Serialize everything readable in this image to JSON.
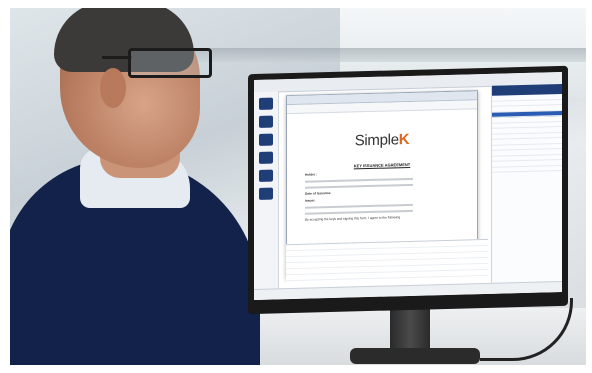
{
  "brand": {
    "logo_main": "Simple",
    "logo_accent": "K",
    "accent_color": "#e0651e",
    "nav_color": "#1f3e78"
  },
  "document": {
    "title": "KEY ISSUANCE AGREEMENT",
    "holder_label": "Holder :",
    "issuer_label": "Issuer:",
    "date_of_issuance_label": "Date of Issuance:",
    "agreement_text": "By accepting the keys and signing this form, I agree to the following"
  }
}
